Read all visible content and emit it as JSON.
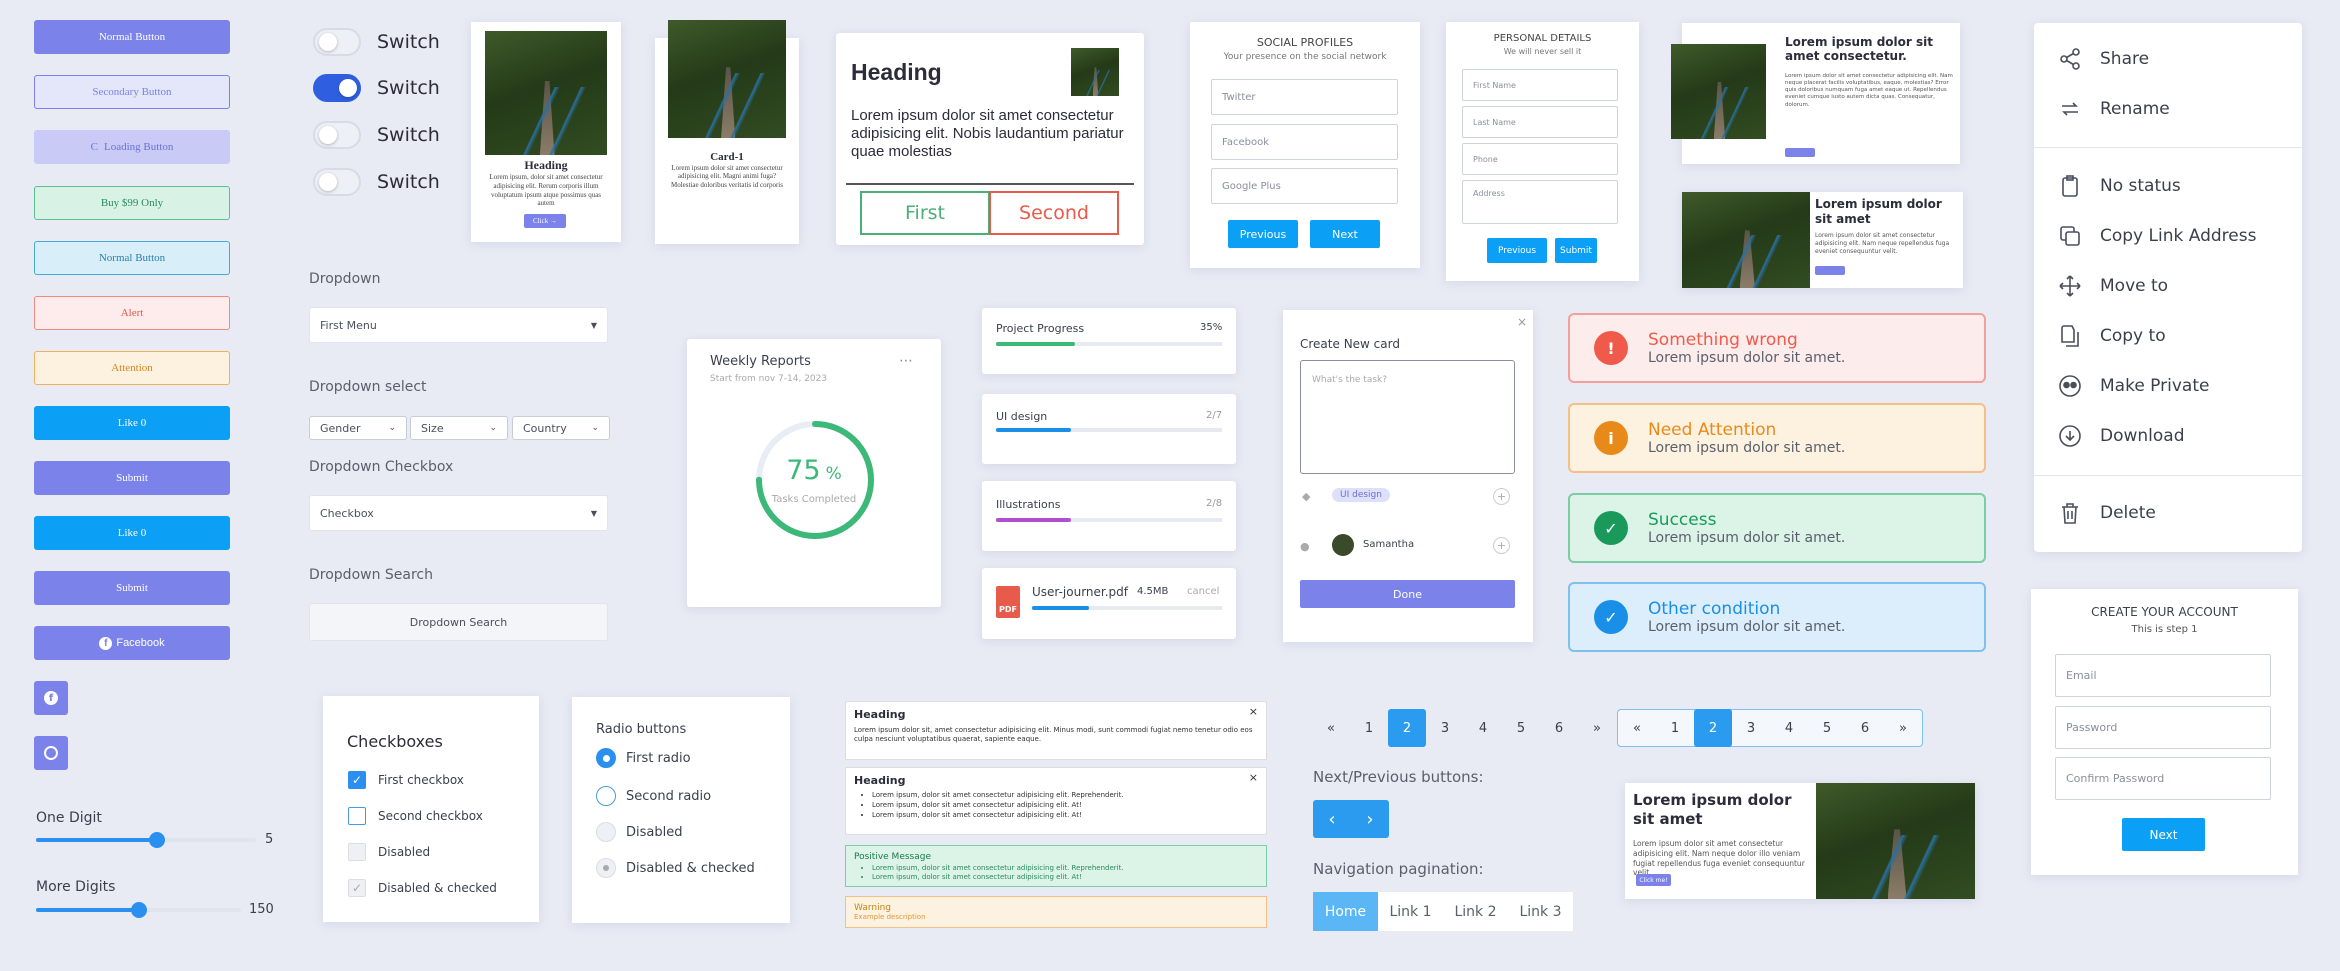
{
  "buttons": {
    "normal": "Normal Button",
    "secondary": "Secondary Button",
    "loading": "Loading Button",
    "buy": "Buy $99 Only",
    "normal2": "Normal Button",
    "alert": "Alert",
    "attention": "Attention",
    "like1": "Like 0",
    "submit1": "Submit",
    "like2": "Like 0",
    "submit2": "Submit",
    "facebook": "Facebook"
  },
  "sliders": {
    "one_label": "One Digit",
    "one_value": "5",
    "one_fraction": 0.55,
    "more_label": "More Digits",
    "more_value": "150",
    "more_fraction": 0.5
  },
  "switches": [
    {
      "label": "Switch",
      "on": false
    },
    {
      "label": "Switch",
      "on": true
    },
    {
      "label": "Switch",
      "on": false
    },
    {
      "label": "Switch",
      "on": false
    }
  ],
  "card1": {
    "heading": "Heading",
    "text": "Lorem ipsum, dolor sit amet consectetur adipisicing elit. Rerum corporis illum voluptatum ipsum atque possimus quas autem",
    "button": "Click →"
  },
  "card2": {
    "heading": "Card-1",
    "text": "Lorem ipsum dolor sit amet consectetur adipisicing elit. Magni animi fuga? Molestiae doloribus veritatis id corporis"
  },
  "card3": {
    "heading": "Heading",
    "text": "Lorem ipsum dolor sit amet consectetur adipisicing elit. Nobis laudantium pariatur quae molestias",
    "first": "First",
    "second": "Second"
  },
  "social": {
    "title": "SOCIAL PROFILES",
    "subtitle": "Your presence on the social network",
    "twitter": "Twitter",
    "facebook": "Facebook",
    "google": "Google Plus",
    "previous": "Previous",
    "next": "Next"
  },
  "personal": {
    "title": "PERSONAL DETAILS",
    "subtitle": "We will never sell it",
    "first": "First Name",
    "last": "Last Name",
    "phone": "Phone",
    "address": "Address",
    "previous": "Previous",
    "submit": "Submit"
  },
  "hcard1": {
    "title": "Lorem ipsum dolor sit amet consectetur.",
    "text": "Lorem ipsum dolor sit amet consectetur adipisicing elit. Nam neque placerat facilis voluptatibus, eaque, molestias? Error quis doloribus numquam fuga amet eaque ut. Repellendus eveniet cumque iusto autem dicta quas. Consequatur, dolorum."
  },
  "hcard2": {
    "title": "Lorem ipsum dolor sit amet",
    "text": "Lorem ipsum dolor sit amet consectetur adipisicing elit. Nam neque repellendus fuga eveniet consequuntur velit."
  },
  "menu": [
    {
      "label": "Share",
      "icon": "share-icon"
    },
    {
      "label": "Rename",
      "icon": "rename-icon"
    },
    {
      "label": "No status",
      "icon": "clipboard-icon"
    },
    {
      "label": "Copy Link Address",
      "icon": "copy-link-icon"
    },
    {
      "label": "Move to",
      "icon": "move-icon"
    },
    {
      "label": "Copy to",
      "icon": "copy-icon"
    },
    {
      "label": "Make Private",
      "icon": "private-icon"
    },
    {
      "label": "Download",
      "icon": "download-icon"
    },
    {
      "label": "Delete",
      "icon": "trash-icon"
    }
  ],
  "dropdowns": {
    "label1": "Dropdown",
    "first_menu": "First Menu",
    "label2": "Dropdown select",
    "gender": "Gender",
    "size": "Size",
    "country": "Country",
    "label3": "Dropdown Checkbox",
    "checkbox": "Checkbox",
    "label4": "Dropdown Search",
    "search": "Dropdown Search"
  },
  "weekly": {
    "title": "Weekly Reports",
    "subtitle": "Start from nov 7-14, 2023",
    "percent": "75",
    "percent_sign": "%",
    "caption": "Tasks Completed",
    "fraction": 0.75
  },
  "progress": [
    {
      "label": "Project Progress",
      "value": "35%",
      "fraction": 0.35,
      "color": "#3cb878"
    },
    {
      "label": "UI design",
      "value": "2/7",
      "fraction": 0.33,
      "color": "#1a8fe8"
    },
    {
      "label": "Illustrations",
      "value": "2/8",
      "fraction": 0.33,
      "color": "#b04fd0"
    }
  ],
  "file": {
    "name": "User-journer.pdf",
    "size": "4.5MB",
    "cancel": "cancel",
    "fraction": 0.3,
    "icon_text": "PDF"
  },
  "newcard": {
    "title": "Create New card",
    "placeholder": "What's the task?",
    "tag": "UI design",
    "user": "Samantha",
    "done": "Done"
  },
  "alerts": [
    {
      "title": "Something wrong",
      "text": "Lorem ipsum dolor sit amet.",
      "color": "#f05a4a"
    },
    {
      "title": "Need Attention",
      "text": "Lorem ipsum dolor sit amet.",
      "color": "#e88a1a"
    },
    {
      "title": "Success",
      "text": "Lorem ipsum dolor sit amet.",
      "color": "#1a9a5a"
    },
    {
      "title": "Other condition",
      "text": "Lorem ipsum dolor sit amet.",
      "color": "#1a8fe8"
    }
  ],
  "account": {
    "title": "CREATE YOUR ACCOUNT",
    "subtitle": "This is step 1",
    "email": "Email",
    "password": "Password",
    "confirm": "Confirm Password",
    "next": "Next"
  },
  "checkboxes": {
    "title": "Checkboxes",
    "items": [
      "First checkbox",
      "Second checkbox",
      "Disabled",
      "Disabled & checked"
    ]
  },
  "radios": {
    "title": "Radio buttons",
    "items": [
      "First radio",
      "Second radio",
      "Disabled",
      "Disabled & checked"
    ]
  },
  "messages": {
    "m1_title": "Heading",
    "m1_text": "Lorem ipsum dolor sit, amet consectetur adipisicing elit. Minus modi, sunt commodi fugiat nemo tenetur odio eos culpa nesciunt voluptatibus quaerat, sapiente eaque.",
    "m2_title": "Heading",
    "m2_items": [
      "Lorem ipsum, dolor sit amet consectetur adipisicing elit. Reprehenderit.",
      "Lorem ipsum, dolor sit amet consectetur adipisicing elit. At!",
      "Lorem ipsum, dolor sit amet consectetur adipisicing elit. At!"
    ],
    "m3_title": "Positive Message",
    "m3_items": [
      "Lorem ipsum, dolor sit amet consectetur adipisicing elit. Reprehenderit.",
      "Lorem ipsum, dolor sit amet consectetur adipisicing elit. At!"
    ],
    "m4_title": "Warning",
    "m4_text": "Example description"
  },
  "pagination": {
    "prev": "«",
    "next": "»",
    "pages": [
      "1",
      "2",
      "3",
      "4",
      "5",
      "6"
    ],
    "np_label": "Next/Previous buttons:",
    "prev_arrow": "‹",
    "next_arrow": "›",
    "nav_label": "Navigation pagination:",
    "nav": [
      "Home",
      "Link 1",
      "Link 2",
      "Link 3"
    ]
  },
  "bcard": {
    "title": "Lorem ipsum dolor sit amet",
    "text": "Lorem ipsum dolor sit amet consectetur adipisicing elit. Nam neque dolor illo veniam fugiat repellendus fuga eveniet consequuntur velit.",
    "button": "Click me!"
  }
}
